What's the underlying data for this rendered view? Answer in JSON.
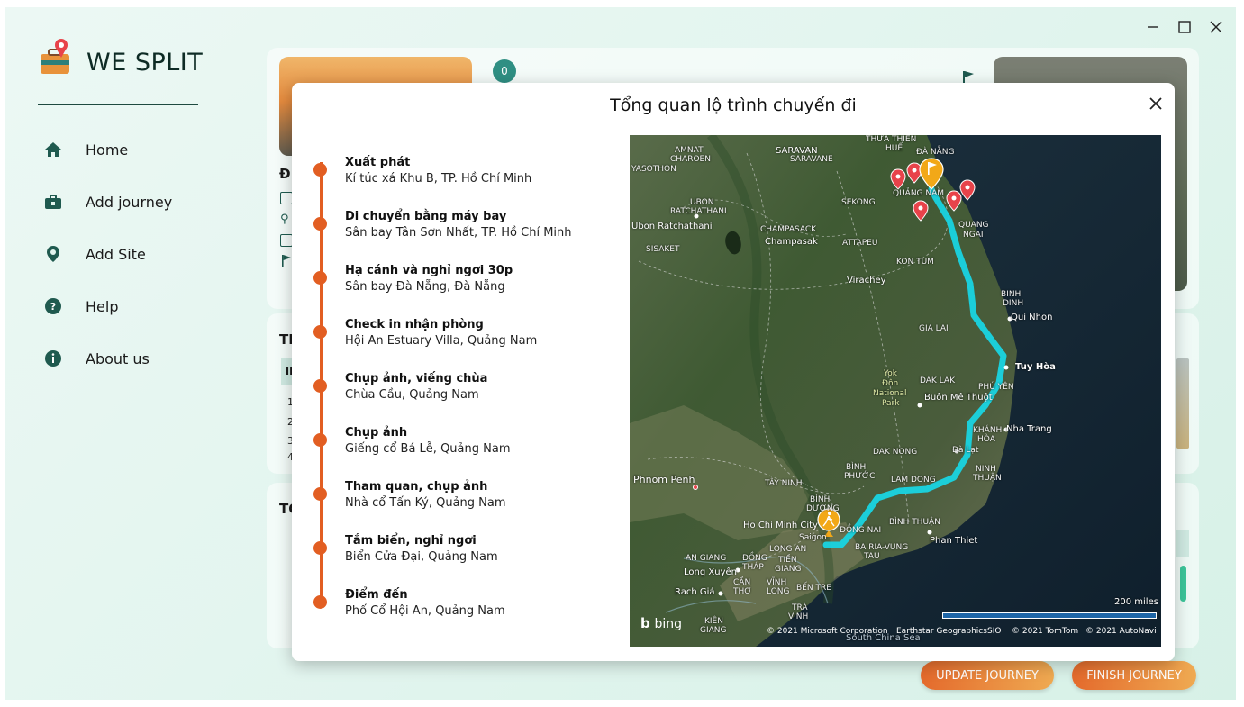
{
  "app": {
    "name": "WE SPLIT"
  },
  "window_controls": {
    "minimize": "—",
    "maximize": "☐",
    "close": "✕"
  },
  "sidebar": {
    "items": [
      {
        "label": "Home",
        "icon": "home-icon"
      },
      {
        "label": "Add journey",
        "icon": "briefcase-icon"
      },
      {
        "label": "Add Site",
        "icon": "location-pin-icon"
      },
      {
        "label": "Help",
        "icon": "help-icon"
      },
      {
        "label": "About us",
        "icon": "info-icon"
      }
    ]
  },
  "background": {
    "badge_count": "0",
    "section_letter_1": "ĐI",
    "section_letter_2": "TH",
    "section_letter_3": "TỔ",
    "table_header": "ID",
    "rows": [
      "1",
      "2",
      "3",
      "4"
    ],
    "update_button": "UPDATE JOURNEY",
    "finish_button": "FINISH JOURNEY"
  },
  "modal": {
    "title": "Tổng quan lộ trình chuyến đi",
    "steps": [
      {
        "title": "Xuất phát",
        "place": "Kí túc xá Khu B, TP. Hồ Chí Minh"
      },
      {
        "title": "Di chuyển bằng máy bay",
        "place": "Sân bay Tân Sơn Nhất, TP. Hồ Chí Minh"
      },
      {
        "title": "Hạ cánh và nghỉ ngơi 30p",
        "place": "Sân bay Đà Nẵng, Đà Nẵng"
      },
      {
        "title": "Check in nhận phòng",
        "place": "Hội An Estuary Villa, Quảng Nam"
      },
      {
        "title": "Chụp ảnh, viếng chùa",
        "place": "Chùa Cầu, Quảng Nam"
      },
      {
        "title": "Chụp ảnh",
        "place": "Giếng cổ Bá Lễ, Quảng Nam"
      },
      {
        "title": "Tham quan, chụp ảnh",
        "place": "Nhà cổ Tấn Ký, Quảng Nam"
      },
      {
        "title": "Tắm biển, nghỉ ngơi",
        "place": "Biển Cửa Đại, Quảng Nam"
      },
      {
        "title": "Điểm đến",
        "place": "Phố Cổ Hội An, Quảng Nam"
      }
    ]
  },
  "map": {
    "labels": {
      "amnat": "AMNAT",
      "charoen": "CHAROEN",
      "yasothon": "YASOTHON",
      "saravan": "SARAVAN",
      "savarane": "SARAVANE",
      "sekong": "SEKONG",
      "thuathien": "THỪA THIÊN",
      "hue": "HUẾ",
      "danang": "ĐÀ NẴNG",
      "quangnam": "QUẢNG NAM",
      "quang": "QUANG",
      "ngai": "NGAI",
      "ubon": "UBON",
      "ratchathani": "RATCHATHANI",
      "ubon_city": "Ubon Ratchathani",
      "sisaket": "SISAKET",
      "champasack": "CHAMPASACK",
      "champasak": "Champasak",
      "attapeu": "ATTAPEU",
      "kontum": "KON TUM",
      "virachey": "Virachey",
      "binh": "BINH",
      "dinh": "DINH",
      "quinhon": "Qui Nhon",
      "gialai": "GIA LAI",
      "tuyhoa": "Tuy Hòa",
      "daklak": "DAK LAK",
      "yok": "Yok",
      "don": "Đôn",
      "national": "National",
      "park": "Park",
      "buonmethuot": "Buôn Mê Thuột",
      "phuyen": "PHÚ YÊN",
      "khanh": "KHÁNH",
      "hoa": "HÒA",
      "nhatrang": "Nha Trang",
      "dalat": "Đà Lạt",
      "daknong": "DAK NONG",
      "binhphuoc": "BÌNH",
      "phuoc": "PHƯỚC",
      "ninh": "NINH",
      "thuan": "THUẬN",
      "tayninh": "TÂY NINH",
      "lamdong": "LAM DONG",
      "phnompenh": "Phnom Penh",
      "binh2": "BÌNH",
      "duong": "DƯƠNG",
      "hochiminh": "Ho Chi Minh City",
      "saigon": "Saigon",
      "dongnai": "ĐỒNG NAI",
      "binhthuan": "BÌNH THUẬN",
      "phanthiet": "Phan Thiet",
      "longan": "LONG AN",
      "bariavungtau": "BA RIA-VUNG",
      "tau": "TAU",
      "angiang": "AN GIANG",
      "dongthap": "ĐỒNG",
      "thap": "THÁP",
      "tien": "TIỀN",
      "giang": "GIANG",
      "longxuyen": "Long Xuyên",
      "rachgia": "Rach Giá",
      "cantho": "CẦN",
      "tho": "THƠ",
      "vinh": "VĨNH",
      "long": "LONG",
      "bentre": "BẾN TRE",
      "kien": "KIÊN",
      "giang2": "GIANG",
      "travinh": "TRÀ",
      "vinh2": "VINH",
      "southchinasea": "South China Sea"
    },
    "scale": "200 miles",
    "logo": "bing",
    "attributions": [
      "© 2021 Microsoft Corporation",
      "Earthstar Geographics",
      "SIO",
      "© 2021 TomTom",
      "© 2021 AutoNavi"
    ]
  },
  "colors": {
    "accent": "#e25e22",
    "route": "#19d4e2",
    "pin": "#e8434a",
    "marker": "#f2a818",
    "sidebar_icon": "#1f5a4f",
    "button_start": "#e46a2c",
    "button_end": "#efaa52"
  }
}
